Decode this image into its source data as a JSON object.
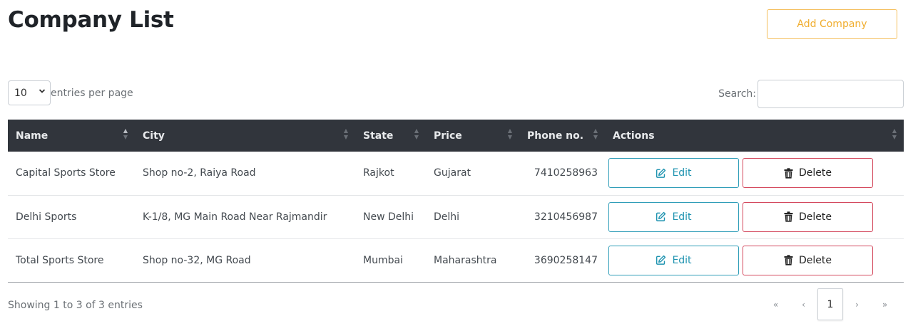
{
  "page": {
    "title": "Company List",
    "add_button": "Add Company"
  },
  "controls": {
    "length_value": "10",
    "length_label": "entries per page",
    "search_label": "Search:",
    "search_value": ""
  },
  "table": {
    "columns": [
      "Name",
      "City",
      "State",
      "Price",
      "Phone no.",
      "Actions"
    ],
    "rows": [
      {
        "name": "Capital Sports Store",
        "city": "Shop no-2, Raiya Road",
        "state": "Rajkot",
        "price": "Gujarat",
        "phone": "7410258963"
      },
      {
        "name": "Delhi Sports",
        "city": "K-1/8, MG Main Road Near Rajmandir",
        "state": "New Delhi",
        "price": "Delhi",
        "phone": "3210456987"
      },
      {
        "name": "Total Sports Store",
        "city": "Shop no-32, MG Road",
        "state": "Mumbai",
        "price": "Maharashtra",
        "phone": "3690258147"
      }
    ],
    "edit_label": "Edit",
    "delete_label": "Delete"
  },
  "footer": {
    "info": "Showing 1 to 3 of 3 entries",
    "pagination": {
      "first": "«",
      "prev": "‹",
      "current": "1",
      "next": "›",
      "last": "»"
    }
  },
  "colors": {
    "header_bg": "#31353c",
    "add_accent": "#f0ad2e",
    "edit_accent": "#1e93b0",
    "delete_accent": "#d4495e"
  }
}
